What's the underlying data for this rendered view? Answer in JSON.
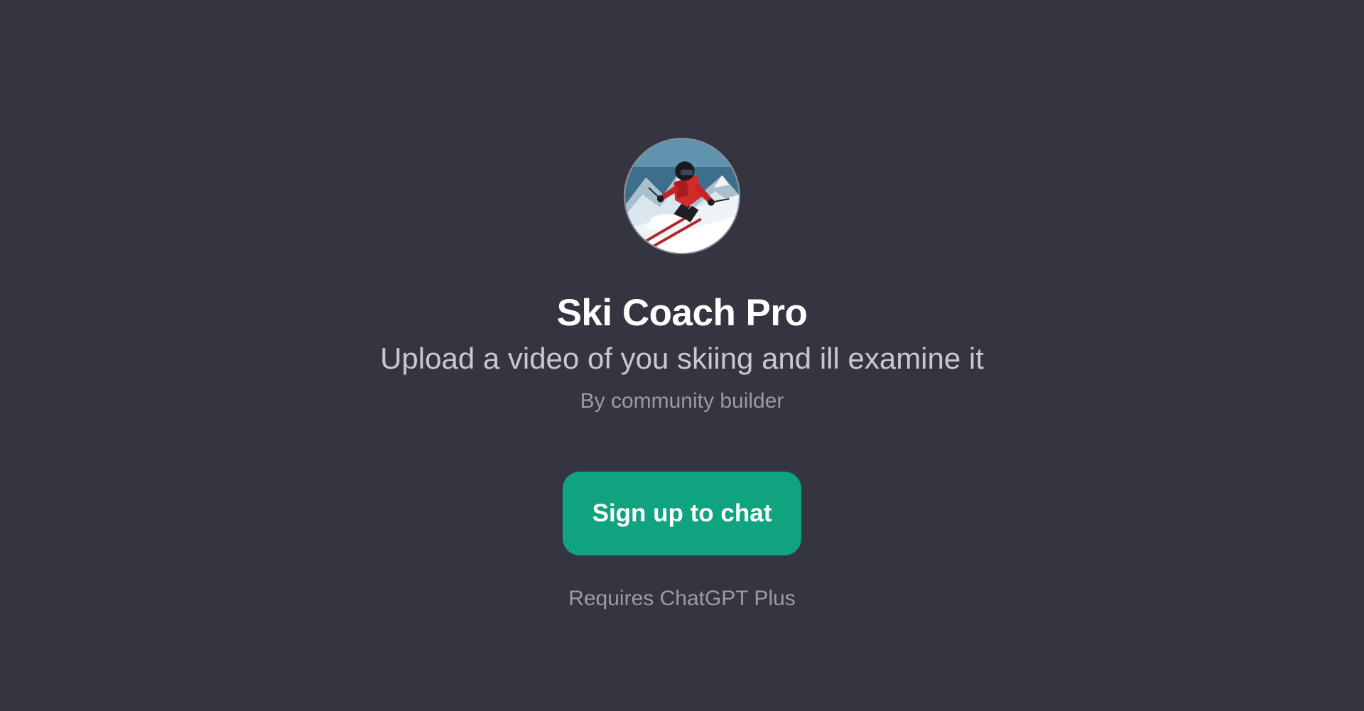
{
  "gpt": {
    "name": "Ski Coach Pro",
    "description": "Upload a video of you skiing and ill examine it",
    "author": "By community builder"
  },
  "actions": {
    "signup_label": "Sign up to chat"
  },
  "footer": {
    "requirement": "Requires ChatGPT Plus"
  },
  "colors": {
    "background": "#343541",
    "accent": "#10a37f",
    "title": "#ffffff",
    "subtitle": "#c8c8d0",
    "muted": "#9a9ba6"
  },
  "avatar": {
    "icon": "skier-avatar-image"
  }
}
